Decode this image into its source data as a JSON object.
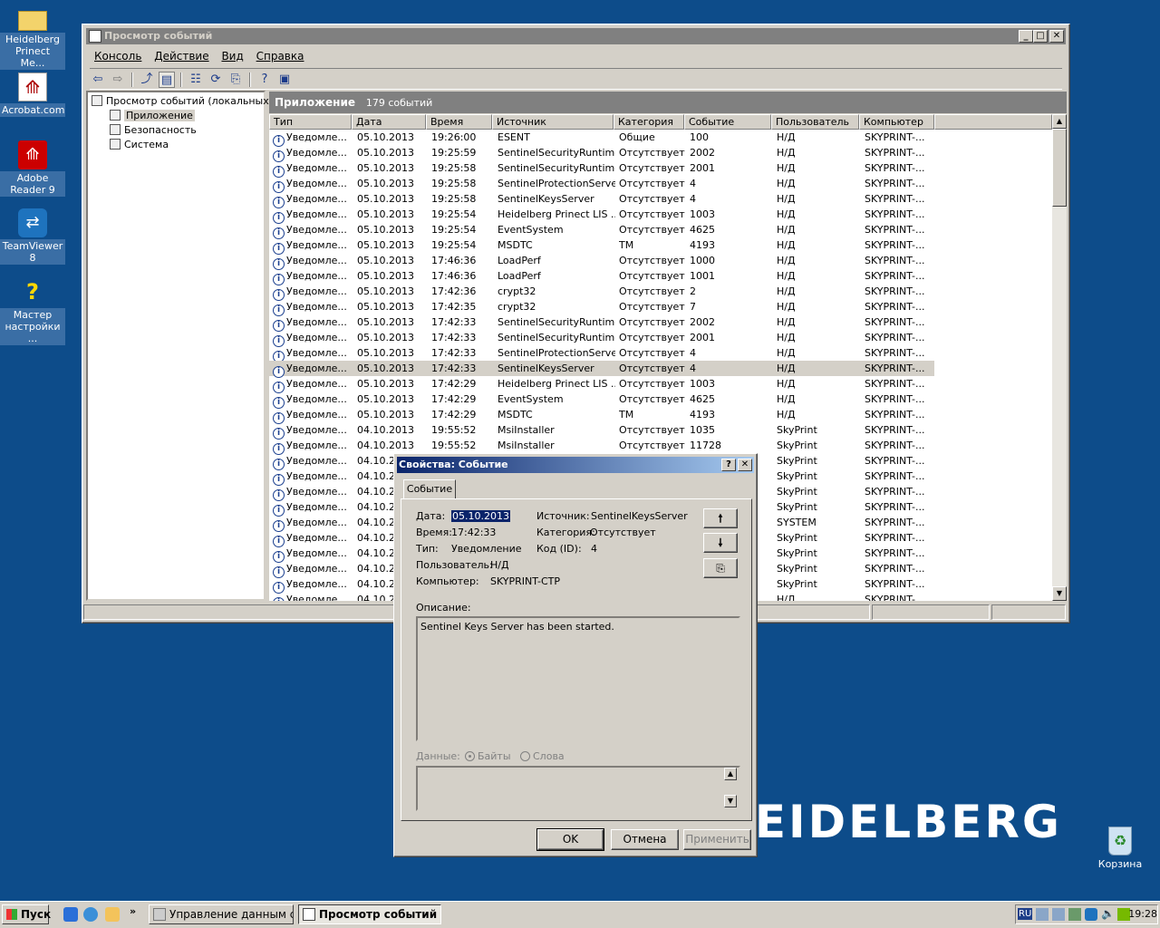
{
  "desktop": {
    "icons": [
      {
        "label": "Heidelberg Prinect Me..."
      },
      {
        "label": "Acrobat.com"
      },
      {
        "label": "Adobe Reader 9"
      },
      {
        "label": "TeamViewer 8"
      },
      {
        "label": "Мастер настройки ..."
      },
      {
        "label": "Корзина"
      }
    ],
    "wallpaper_logo": "HEIDELBERG"
  },
  "window": {
    "title": "Просмотр событий",
    "menu": [
      "Консоль",
      "Действие",
      "Вид",
      "Справка"
    ],
    "tree": {
      "root": "Просмотр событий (локальных)",
      "children": [
        "Приложение",
        "Безопасность",
        "Система"
      ]
    },
    "list_header": {
      "name": "Приложение",
      "count": "179 событий"
    },
    "columns": [
      "Тип",
      "Дата",
      "Время",
      "Источник",
      "Категория",
      "Событие",
      "Пользователь",
      "Компьютер"
    ],
    "rows": [
      [
        "Уведомле...",
        "05.10.2013",
        "19:26:00",
        "ESENT",
        "Общие",
        "100",
        "Н/Д",
        "SKYPRINT-..."
      ],
      [
        "Уведомле...",
        "05.10.2013",
        "19:25:59",
        "SentinelSecurityRuntime",
        "Отсутствует",
        "2002",
        "Н/Д",
        "SKYPRINT-..."
      ],
      [
        "Уведомле...",
        "05.10.2013",
        "19:25:58",
        "SentinelSecurityRuntime",
        "Отсутствует",
        "2001",
        "Н/Д",
        "SKYPRINT-..."
      ],
      [
        "Уведомле...",
        "05.10.2013",
        "19:25:58",
        "SentinelProtectionServer",
        "Отсутствует",
        "4",
        "Н/Д",
        "SKYPRINT-..."
      ],
      [
        "Уведомле...",
        "05.10.2013",
        "19:25:58",
        "SentinelKeysServer",
        "Отсутствует",
        "4",
        "Н/Д",
        "SKYPRINT-..."
      ],
      [
        "Уведомле...",
        "05.10.2013",
        "19:25:54",
        "Heidelberg Prinect LIS ...",
        "Отсутствует",
        "1003",
        "Н/Д",
        "SKYPRINT-..."
      ],
      [
        "Уведомле...",
        "05.10.2013",
        "19:25:54",
        "EventSystem",
        "Отсутствует",
        "4625",
        "Н/Д",
        "SKYPRINT-..."
      ],
      [
        "Уведомле...",
        "05.10.2013",
        "19:25:54",
        "MSDTC",
        "TM",
        "4193",
        "Н/Д",
        "SKYPRINT-..."
      ],
      [
        "Уведомле...",
        "05.10.2013",
        "17:46:36",
        "LoadPerf",
        "Отсутствует",
        "1000",
        "Н/Д",
        "SKYPRINT-..."
      ],
      [
        "Уведомле...",
        "05.10.2013",
        "17:46:36",
        "LoadPerf",
        "Отсутствует",
        "1001",
        "Н/Д",
        "SKYPRINT-..."
      ],
      [
        "Уведомле...",
        "05.10.2013",
        "17:42:36",
        "crypt32",
        "Отсутствует",
        "2",
        "Н/Д",
        "SKYPRINT-..."
      ],
      [
        "Уведомле...",
        "05.10.2013",
        "17:42:35",
        "crypt32",
        "Отсутствует",
        "7",
        "Н/Д",
        "SKYPRINT-..."
      ],
      [
        "Уведомле...",
        "05.10.2013",
        "17:42:33",
        "SentinelSecurityRuntime",
        "Отсутствует",
        "2002",
        "Н/Д",
        "SKYPRINT-..."
      ],
      [
        "Уведомле...",
        "05.10.2013",
        "17:42:33",
        "SentinelSecurityRuntime",
        "Отсутствует",
        "2001",
        "Н/Д",
        "SKYPRINT-..."
      ],
      [
        "Уведомле...",
        "05.10.2013",
        "17:42:33",
        "SentinelProtectionServer",
        "Отсутствует",
        "4",
        "Н/Д",
        "SKYPRINT-..."
      ],
      [
        "Уведомле...",
        "05.10.2013",
        "17:42:33",
        "SentinelKeysServer",
        "Отсутствует",
        "4",
        "Н/Д",
        "SKYPRINT-..."
      ],
      [
        "Уведомле...",
        "05.10.2013",
        "17:42:29",
        "Heidelberg Prinect LIS ...",
        "Отсутствует",
        "1003",
        "Н/Д",
        "SKYPRINT-..."
      ],
      [
        "Уведомле...",
        "05.10.2013",
        "17:42:29",
        "EventSystem",
        "Отсутствует",
        "4625",
        "Н/Д",
        "SKYPRINT-..."
      ],
      [
        "Уведомле...",
        "05.10.2013",
        "17:42:29",
        "MSDTC",
        "TM",
        "4193",
        "Н/Д",
        "SKYPRINT-..."
      ],
      [
        "Уведомле...",
        "04.10.2013",
        "19:55:52",
        "MsiInstaller",
        "Отсутствует",
        "1035",
        "SkyPrint",
        "SKYPRINT-..."
      ],
      [
        "Уведомле...",
        "04.10.2013",
        "19:55:52",
        "MsiInstaller",
        "Отсутствует",
        "11728",
        "SkyPrint",
        "SKYPRINT-..."
      ],
      [
        "Уведомле...",
        "04.10.20",
        "",
        "",
        "",
        "",
        "SkyPrint",
        "SKYPRINT-..."
      ],
      [
        "Уведомле...",
        "04.10.20",
        "",
        "",
        "",
        "",
        "SkyPrint",
        "SKYPRINT-..."
      ],
      [
        "Уведомле...",
        "04.10.20",
        "",
        "",
        "",
        "",
        "SkyPrint",
        "SKYPRINT-..."
      ],
      [
        "Уведомле...",
        "04.10.20",
        "",
        "",
        "",
        "",
        "SkyPrint",
        "SKYPRINT-..."
      ],
      [
        "Уведомле...",
        "04.10.20",
        "",
        "",
        "",
        "",
        "SYSTEM",
        "SKYPRINT-..."
      ],
      [
        "Уведомле...",
        "04.10.20",
        "",
        "",
        "",
        "",
        "SkyPrint",
        "SKYPRINT-..."
      ],
      [
        "Уведомле...",
        "04.10.20",
        "",
        "",
        "",
        "",
        "SkyPrint",
        "SKYPRINT-..."
      ],
      [
        "Уведомле...",
        "04.10.20",
        "",
        "",
        "",
        "",
        "SkyPrint",
        "SKYPRINT-..."
      ],
      [
        "Уведомле...",
        "04.10.20",
        "",
        "",
        "",
        "",
        "SkyPrint",
        "SKYPRINT-..."
      ],
      [
        "Уведомле...",
        "04.10.20",
        "",
        "",
        "",
        "",
        "Н/Д",
        "SKYPRINT-..."
      ]
    ],
    "selected_row": 15
  },
  "dialog": {
    "title": "Свойства: Событие",
    "tab": "Событие",
    "date_label": "Дата:",
    "date": "05.10.2013",
    "time_label": "Время:",
    "time": "17:42:33",
    "type_label": "Тип:",
    "type": "Уведомление",
    "user_label": "Пользователь:",
    "user": "Н/Д",
    "computer_label": "Компьютер:",
    "computer": "SKYPRINT-CTP",
    "source_label": "Источник:",
    "source": "SentinelKeysServer",
    "category_label": "Категория:",
    "category": "Отсутствует",
    "id_label": "Код (ID):",
    "id": "4",
    "desc_label": "Описание:",
    "description": "Sentinel Keys Server has been started.",
    "data_label": "Данные:",
    "bytes": "Байты",
    "words": "Слова",
    "ok": "OK",
    "cancel": "Отмена",
    "apply": "Применить"
  },
  "taskbar": {
    "start": "Пуск",
    "tasks": [
      "Управление данным се...",
      "Просмотр событий"
    ],
    "lang": "RU",
    "clock": "19:28"
  }
}
